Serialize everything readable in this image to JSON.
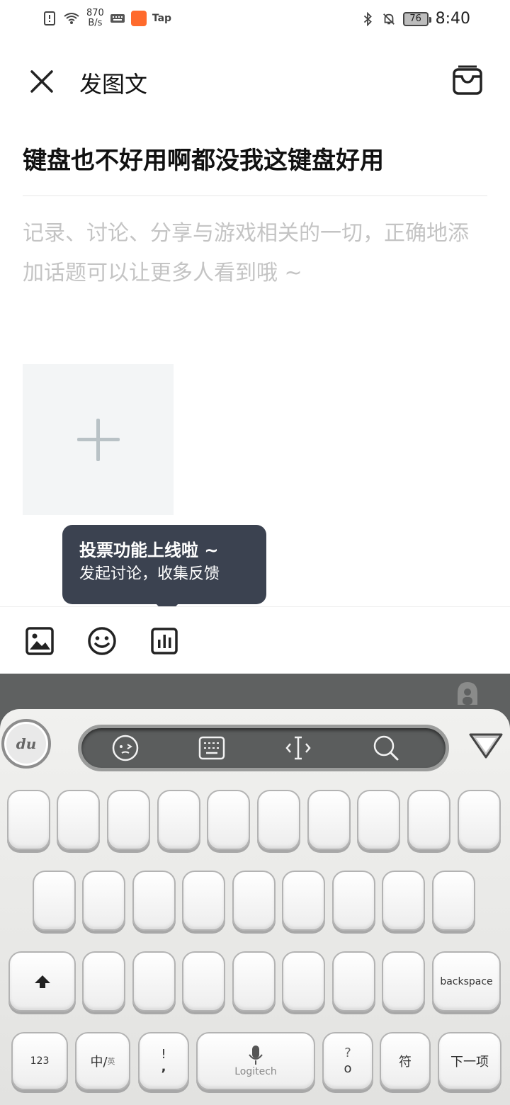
{
  "status_bar": {
    "net_speed_value": "870",
    "net_speed_unit": "B/s",
    "tap_label": "Tap",
    "battery": "76",
    "time": "8:40"
  },
  "header": {
    "title": "发图文"
  },
  "post": {
    "title": "键盘也不好用啊都没我这键盘好用",
    "body_placeholder": "记录、讨论、分享与游戏相关的一切，正确地添加话题可以让更多人看到哦 ~"
  },
  "tooltip": {
    "title": "投票功能上线啦 ~",
    "subtitle": "发起讨论，收集反馈"
  },
  "keyboard": {
    "logo": "du",
    "shift_key": "shift",
    "backspace": "backspace",
    "num_key": "123",
    "lang_key_main": "中/",
    "lang_key_sub": "英",
    "punct_key_top": "!",
    "punct_key_bottom": ",",
    "space_brand": "Logitech",
    "question_key": "?",
    "question_key_sub": "o",
    "symbol_key": "符",
    "next_key": "下一项",
    "colors": {
      "frame": "#5f6161",
      "body": "#efefed",
      "key": "#ffffff"
    }
  }
}
